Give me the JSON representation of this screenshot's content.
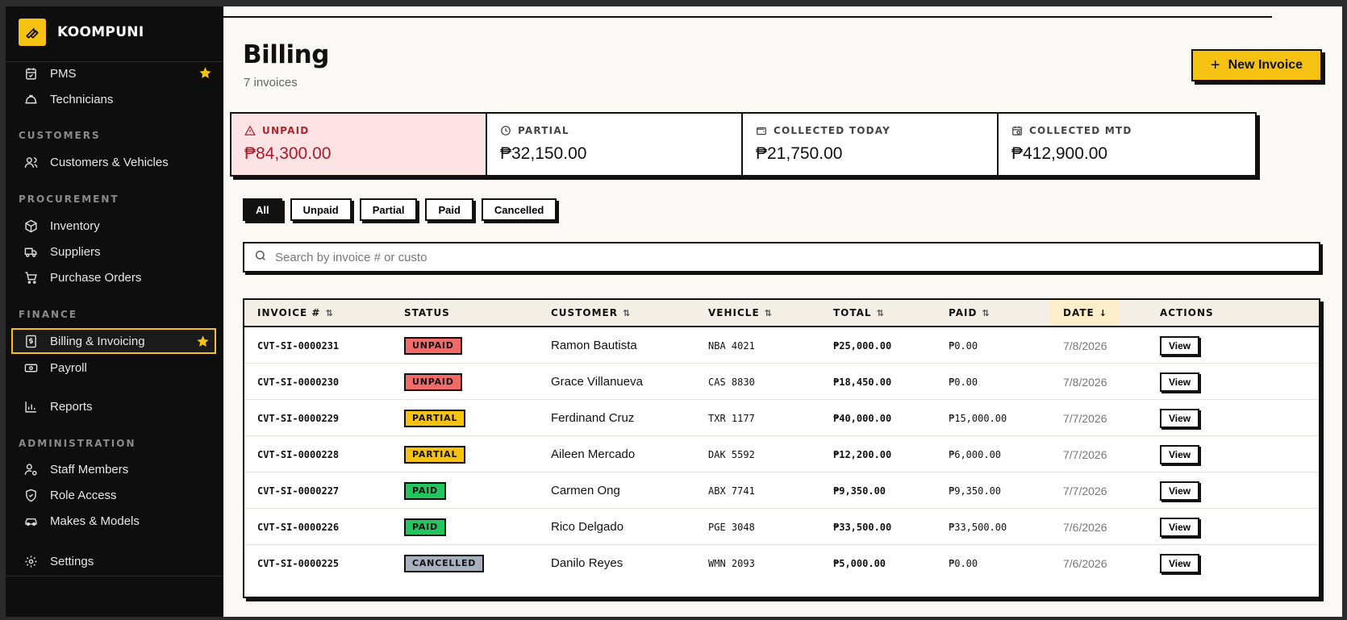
{
  "brand": {
    "name": "KOOMPUNI"
  },
  "colors": {
    "accent": "#f5c211",
    "unpaid": "#f06a6a",
    "partial": "#f5c211",
    "paid": "#22c55e",
    "cancelled": "#a8b0bd"
  },
  "sidebar": {
    "items": [
      {
        "label": "PMS",
        "icon": "clipboard-calendar-icon",
        "starred": true
      },
      {
        "label": "Technicians",
        "icon": "hard-hat-icon"
      },
      {
        "label": "Customers & Vehicles",
        "icon": "users-icon"
      },
      {
        "label": "Inventory",
        "icon": "box-icon"
      },
      {
        "label": "Suppliers",
        "icon": "truck-icon"
      },
      {
        "label": "Purchase Orders",
        "icon": "cart-icon"
      },
      {
        "label": "Billing & Invoicing",
        "icon": "receipt-dollar-icon",
        "starred": true,
        "active": true
      },
      {
        "label": "Payroll",
        "icon": "banknote-icon"
      },
      {
        "label": "Reports",
        "icon": "bar-chart-icon"
      },
      {
        "label": "Staff Members",
        "icon": "user-cog-icon"
      },
      {
        "label": "Role Access",
        "icon": "shield-check-icon"
      },
      {
        "label": "Makes & Models",
        "icon": "car-icon"
      },
      {
        "label": "Settings",
        "icon": "gear-icon"
      }
    ],
    "sections": {
      "customers": "CUSTOMERS",
      "procurement": "PROCUREMENT",
      "finance": "FINANCE",
      "administration": "ADMINISTRATION"
    }
  },
  "page": {
    "title": "Billing",
    "subtitle": "7 invoices",
    "new_invoice_label": "New Invoice"
  },
  "stats": [
    {
      "label": "UNPAID",
      "value": "₱84,300.00",
      "icon": "alert-triangle-icon"
    },
    {
      "label": "PARTIAL",
      "value": "₱32,150.00",
      "icon": "clock-icon"
    },
    {
      "label": "COLLECTED TODAY",
      "value": "₱21,750.00",
      "icon": "wallet-icon"
    },
    {
      "label": "COLLECTED MTD",
      "value": "₱412,900.00",
      "icon": "calendar-clock-icon"
    }
  ],
  "filters": [
    "All",
    "Unpaid",
    "Partial",
    "Paid",
    "Cancelled"
  ],
  "active_filter": "All",
  "search": {
    "placeholder": "Search by invoice # or custo",
    "value": ""
  },
  "table": {
    "columns": [
      "INVOICE #",
      "STATUS",
      "CUSTOMER",
      "VEHICLE",
      "TOTAL",
      "PAID",
      "DATE",
      "ACTIONS"
    ],
    "sort_column": "DATE",
    "rows": [
      {
        "invoice": "CVT-SI-0000231",
        "status": "UNPAID",
        "customer": "Ramon Bautista",
        "vehicle": "NBA 4021",
        "total": "₱25,000.00",
        "paid": "₱0.00",
        "date": "7/8/2026",
        "action": "View"
      },
      {
        "invoice": "CVT-SI-0000230",
        "status": "UNPAID",
        "customer": "Grace Villanueva",
        "vehicle": "CAS 8830",
        "total": "₱18,450.00",
        "paid": "₱0.00",
        "date": "7/8/2026",
        "action": "View"
      },
      {
        "invoice": "CVT-SI-0000229",
        "status": "PARTIAL",
        "customer": "Ferdinand Cruz",
        "vehicle": "TXR 1177",
        "total": "₱40,000.00",
        "paid": "₱15,000.00",
        "date": "7/7/2026",
        "action": "View"
      },
      {
        "invoice": "CVT-SI-0000228",
        "status": "PARTIAL",
        "customer": "Aileen Mercado",
        "vehicle": "DAK 5592",
        "total": "₱12,200.00",
        "paid": "₱6,000.00",
        "date": "7/7/2026",
        "action": "View"
      },
      {
        "invoice": "CVT-SI-0000227",
        "status": "PAID",
        "customer": "Carmen Ong",
        "vehicle": "ABX 7741",
        "total": "₱9,350.00",
        "paid": "₱9,350.00",
        "date": "7/7/2026",
        "action": "View"
      },
      {
        "invoice": "CVT-SI-0000226",
        "status": "PAID",
        "customer": "Rico Delgado",
        "vehicle": "PGE 3048",
        "total": "₱33,500.00",
        "paid": "₱33,500.00",
        "date": "7/6/2026",
        "action": "View"
      },
      {
        "invoice": "CVT-SI-0000225",
        "status": "CANCELLED",
        "customer": "Danilo Reyes",
        "vehicle": "WMN 2093",
        "total": "₱5,000.00",
        "paid": "₱0.00",
        "date": "7/6/2026",
        "action": "View"
      }
    ]
  }
}
